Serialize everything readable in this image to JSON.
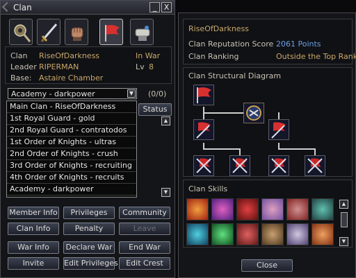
{
  "window": {
    "title": "Clan",
    "minimize_glyph": "_",
    "close_glyph": "X",
    "tabs": [
      {
        "name": "tab-clan-info",
        "icon": "hammer-icon"
      },
      {
        "name": "tab-clan-war",
        "icon": "sword-icon"
      },
      {
        "name": "tab-clan-hall",
        "icon": "fist-icon"
      },
      {
        "name": "tab-clan",
        "icon": "flag-icon",
        "active": true
      },
      {
        "name": "tab-warehouse",
        "icon": "scroll-icon"
      }
    ]
  },
  "clan": {
    "clan_label": "Clan",
    "clan_value": "RiseOfDarkness",
    "leader_label": "Leader",
    "leader_value": "RIPERMAN",
    "base_label": "Base:",
    "base_value": "Astaire Chamber",
    "war_status": "In War",
    "level_label": "Lv",
    "level_value": "8"
  },
  "members": {
    "selected_unit": "Academy - darkpower",
    "count": "(0/0)",
    "status_label": "Status",
    "units": [
      "Main Clan - RiseOfDarkness",
      "1st Royal Guard - gold",
      "2nd Royal Guard - contratodos",
      "1st Order of Knights - ultras",
      "2nd Order of Knights - crush",
      "3rd Order of Knights - recruiting",
      "4th Order of Knights - recruits",
      "Academy - darkpower"
    ]
  },
  "buttons": {
    "member_info": "Member Info",
    "privileges": "Privileges",
    "community": "Community",
    "clan_info": "Clan Info",
    "penalty": "Penalty",
    "leave": "Leave",
    "war_info": "War Info",
    "declare_war": "Declare War",
    "end_war": "End War",
    "invite": "Invite",
    "edit_privileges": "Edit Privileges",
    "edit_crest": "Edit Crest"
  },
  "right": {
    "clan_name": "RiseOfDarkness",
    "reputation_label": "Clan Reputation Score",
    "reputation_value": "2061 Points",
    "ranking_label": "Clan Ranking",
    "ranking_value": "Outside the Top Ranks",
    "diagram_title": "Clan Structural Diagram",
    "skills_title": "Clan Skills",
    "close_label": "Close"
  },
  "colors": {
    "accent_gold": "#c9a86a",
    "points_blue": "#6aa0e8",
    "rank_gold": "#c9a86a"
  }
}
